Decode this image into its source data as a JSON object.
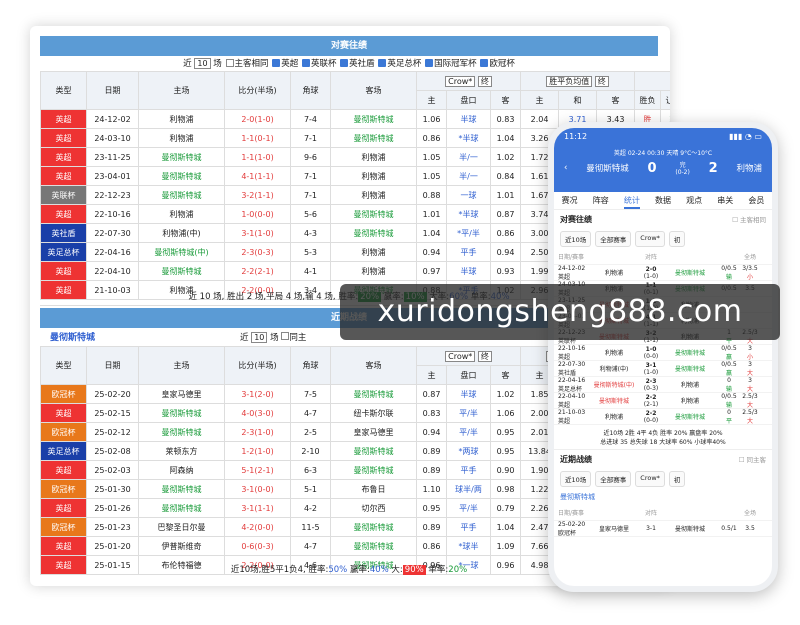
{
  "h2h": {
    "title": "对赛往绩",
    "filter": {
      "near": "近",
      "count": "10",
      "unit": "场",
      "same": "主客相同",
      "tags": [
        "英超",
        "英联杯",
        "英社盾",
        "英足总杯",
        "国际冠军杯",
        "欧冠杯"
      ]
    },
    "odds_sel": "Crow*",
    "end_sel": "终",
    "avg_sel": "胜平负均值",
    "all_sel": "全场",
    "head": [
      "类型",
      "日期",
      "主场",
      "比分(半场)",
      "角球",
      "客场",
      "主",
      "盘口",
      "客",
      "主",
      "和",
      "客",
      "胜负",
      "让球",
      "进球数"
    ],
    "rows": [
      {
        "t": "英超",
        "c": "#e33",
        "d": "24-12-02",
        "h": "利物浦",
        "hc": "",
        "s": "2-0(1-0)",
        "k": "7-4",
        "a": "曼彻斯特城",
        "ac": "grn",
        "o1": "1.06",
        "p": "半球",
        "o2": "0.83",
        "e1": "2.04",
        "e2": "3.71",
        "e3": "3.43",
        "r1": "胜",
        "r2": "输",
        "r3": "小"
      },
      {
        "t": "英超",
        "c": "#e33",
        "d": "24-03-10",
        "h": "利物浦",
        "hc": "",
        "s": "1-1(0-1)",
        "k": "7-1",
        "a": "曼彻斯特城",
        "ac": "grn",
        "o1": "0.86",
        "p": "*半球",
        "o2": "1.04",
        "e1": "3.26",
        "e2": "3.80",
        "e3": "2.08",
        "r1": "",
        "r2": "",
        "r3": ""
      },
      {
        "t": "英超",
        "c": "#e33",
        "d": "23-11-25",
        "h": "曼彻斯特城",
        "hc": "grn",
        "s": "1-1(1-0)",
        "k": "9-6",
        "a": "利物浦",
        "ac": "",
        "o1": "1.05",
        "p": "半/一",
        "o2": "1.02",
        "e1": "1.72",
        "e2": "4.21",
        "e3": "4.21",
        "r1": "",
        "r2": "",
        "r3": ""
      },
      {
        "t": "英超",
        "c": "#e33",
        "d": "23-04-01",
        "h": "曼彻斯特城",
        "hc": "grn",
        "s": "4-1(1-1)",
        "k": "7-1",
        "a": "利物浦",
        "ac": "",
        "o1": "1.05",
        "p": "半/一",
        "o2": "0.84",
        "e1": "1.61",
        "e2": "4.23",
        "e3": "5.23",
        "r1": "",
        "r2": "",
        "r3": ""
      },
      {
        "t": "英联杯",
        "c": "#777",
        "d": "22-12-23",
        "h": "曼彻斯特城",
        "hc": "grn",
        "s": "3-2(1-1)",
        "k": "7-1",
        "a": "利物浦",
        "ac": "",
        "o1": "0.88",
        "p": "一球",
        "o2": "1.01",
        "e1": "1.67",
        "e2": "4.19",
        "e3": "4.60",
        "r1": "",
        "r2": "",
        "r3": ""
      },
      {
        "t": "英超",
        "c": "#e33",
        "d": "22-10-16",
        "h": "利物浦",
        "hc": "",
        "s": "1-0(0-0)",
        "k": "5-6",
        "a": "曼彻斯特城",
        "ac": "grn",
        "o1": "1.01",
        "p": "*半球",
        "o2": "0.87",
        "e1": "3.74",
        "e2": "4.08",
        "e3": "1.87",
        "r1": "",
        "r2": "",
        "r3": ""
      },
      {
        "t": "英社盾",
        "c": "#1a3fa8",
        "d": "22-07-30",
        "h": "利物浦(中)",
        "hc": "",
        "s": "3-1(1-0)",
        "k": "4-3",
        "a": "曼彻斯特城",
        "ac": "grn",
        "o1": "1.04",
        "p": "*平/半",
        "o2": "0.86",
        "e1": "3.00",
        "e2": "3.53",
        "e3": "2.33",
        "r1": "",
        "r2": "",
        "r3": ""
      },
      {
        "t": "英足总杯",
        "c": "#1a3fa8",
        "d": "22-04-16",
        "h": "曼彻斯特城(中)",
        "hc": "grn",
        "s": "2-3(0-3)",
        "k": "5-3",
        "a": "利物浦",
        "ac": "",
        "o1": "0.94",
        "p": "平手",
        "o2": "0.94",
        "e1": "2.50",
        "e2": "3.38",
        "e3": "2.77",
        "r1": "",
        "r2": "",
        "r3": ""
      },
      {
        "t": "英超",
        "c": "#e33",
        "d": "22-04-10",
        "h": "曼彻斯特城",
        "hc": "grn",
        "s": "2-2(2-1)",
        "k": "4-1",
        "a": "利物浦",
        "ac": "",
        "o1": "0.97",
        "p": "半球",
        "o2": "0.93",
        "e1": "1.99",
        "e2": "3.67",
        "e3": "3.64",
        "r1": "",
        "r2": "",
        "r3": ""
      },
      {
        "t": "英超",
        "c": "#e33",
        "d": "21-10-03",
        "h": "利物浦",
        "hc": "",
        "s": "2-2(0-0)",
        "k": "3-4",
        "a": "曼彻斯特城",
        "ac": "grn",
        "o1": "0.88",
        "p": "*平手",
        "o2": "1.02",
        "e1": "2.96",
        "e2": "3.54",
        "e3": "2.33",
        "r1": "",
        "r2": "",
        "r3": ""
      }
    ],
    "foot": {
      "text": "近 10 场, 胜出 2 场,平局 4 场,输 4 场, 胜率:",
      "win": "20%",
      "dx": "赢率:",
      "dxv": "10%",
      "big": "大率:",
      "bigv": "60%",
      "sp": "单率:",
      "spv": "40%"
    }
  },
  "recent": {
    "title": "近期战绩",
    "team": "曼彻斯特城",
    "filter": {
      "near": "近",
      "count": "10",
      "unit": "场",
      "same": "同主",
      "tags": [
        "英超",
        "欧冠杯",
        "英足总杯",
        "英联杯"
      ]
    },
    "rows": [
      {
        "t": "欧冠杯",
        "c": "#e8781b",
        "d": "25-02-20",
        "h": "皇家马德里",
        "s": "3-1(2-0)",
        "k": "7-5",
        "a": "曼彻斯特城",
        "o1": "0.87",
        "p": "半球",
        "o2": "1.02",
        "e1": "1.85",
        "e2": "4.23",
        "e3": "3.69"
      },
      {
        "t": "英超",
        "c": "#e33",
        "d": "25-02-15",
        "h": "曼彻斯特城",
        "s": "4-0(3-0)",
        "k": "4-7",
        "a": "纽卡斯尔联",
        "o1": "0.83",
        "p": "平/半",
        "o2": "1.06",
        "e1": "2.00",
        "e2": "4.01",
        "e3": "3.55"
      },
      {
        "t": "欧冠杯",
        "c": "#e8781b",
        "d": "25-02-12",
        "h": "曼彻斯特城",
        "s": "2-3(1-0)",
        "k": "2-5",
        "a": "皇家马德里",
        "o1": "0.94",
        "p": "平/半",
        "o2": "0.95",
        "e1": "2.01",
        "e2": "3.92",
        "e3": "3.39"
      },
      {
        "t": "英足总杯",
        "c": "#1a3fa8",
        "d": "25-02-08",
        "h": "莱顿东方",
        "s": "1-2(1-0)",
        "k": "2-10",
        "a": "曼彻斯特城",
        "o1": "0.89",
        "p": "*两球",
        "o2": "0.95",
        "e1": "13.84",
        "e2": "7.73",
        "e3": "1.17"
      },
      {
        "t": "英超",
        "c": "#e33",
        "d": "25-02-03",
        "h": "阿森纳",
        "s": "5-1(2-1)",
        "k": "6-3",
        "a": "曼彻斯特城",
        "o1": "0.89",
        "p": "平手",
        "o2": "0.90",
        "e1": "1.90",
        "e2": "3.89",
        "e3": "3.55"
      },
      {
        "t": "欧冠杯",
        "c": "#e8781b",
        "d": "25-01-30",
        "h": "曼彻斯特城",
        "s": "3-1(0-0)",
        "k": "5-1",
        "a": "布鲁日",
        "o1": "1.10",
        "p": "球半/两",
        "o2": "0.98",
        "e1": "1.22",
        "e2": "6.89",
        "e3": "11.64"
      },
      {
        "t": "英超",
        "c": "#e33",
        "d": "25-01-26",
        "h": "曼彻斯特城",
        "s": "3-1(1-1)",
        "k": "4-2",
        "a": "切尔西",
        "o1": "0.95",
        "p": "平/半",
        "o2": "0.79",
        "e1": "2.26",
        "e2": "3.81",
        "e3": "2.89"
      },
      {
        "t": "欧冠杯",
        "c": "#e8781b",
        "d": "25-01-23",
        "h": "巴黎圣日尔曼",
        "s": "4-2(0-0)",
        "k": "11-5",
        "a": "曼彻斯特城",
        "o1": "0.89",
        "p": "平手",
        "o2": "1.04",
        "e1": "2.47",
        "e2": "3.64",
        "e3": "2.59"
      },
      {
        "t": "英超",
        "c": "#e33",
        "d": "25-01-20",
        "h": "伊普斯维奇",
        "s": "0-6(0-3)",
        "k": "4-7",
        "a": "曼彻斯特城",
        "o1": "0.86",
        "p": "*球半",
        "o2": "1.09",
        "e1": "7.66",
        "e2": "5.19",
        "e3": "1.38"
      },
      {
        "t": "英超",
        "c": "#e33",
        "d": "25-01-15",
        "h": "布伦特福德",
        "s": "2-2(0-0)",
        "k": "4-6",
        "a": "曼彻斯特城",
        "o1": "0.96",
        "p": "*一球",
        "o2": "0.96",
        "e1": "4.98",
        "e2": "4.46",
        "e3": "1.66"
      }
    ],
    "foot": {
      "text": "近10场,胜5平1负4, 胜率:",
      "win": "50%",
      "dx": "赢率:",
      "dxv": "40%",
      "big": "大:",
      "bigv": "90%",
      "sp": "单率:",
      "spv": "20%"
    }
  },
  "watermark": "xuridongsheng888.com",
  "phone": {
    "time": "11:12",
    "league": "英超",
    "datetime": "02-24 00:30",
    "weather": "天晴 9°C～10°C",
    "home": "曼彻斯特城",
    "away": "利物浦",
    "score_h": "0",
    "score_a": "2",
    "vs": "完",
    "half": "(0-2)",
    "tabs": [
      "赛况",
      "阵容",
      "统计",
      "数据",
      "观点",
      "串关",
      "会员"
    ],
    "active_tab": "统计",
    "sec1": "对赛往绩",
    "same": "主客相同",
    "f1": [
      "近10场",
      "全部赛事",
      "Crow*",
      "初"
    ],
    "cols": [
      "日期/赛事",
      "",
      "对阵",
      "",
      "全场"
    ],
    "rows": [
      {
        "d": "24-12-02",
        "l": "英超",
        "h": "利物浦",
        "s": "2-0",
        "hs": "(1-0)",
        "a": "曼彻斯特城",
        "o": "0/0.5",
        "ox": "输",
        "g": "3/3.5",
        "gx": "小"
      },
      {
        "d": "24-03-10",
        "l": "英超",
        "h": "利物浦",
        "s": "1-1",
        "hs": "(0-1)",
        "a": "曼彻斯特城",
        "o": "0/0.5",
        "ox": "",
        "g": "3.5",
        "gx": ""
      },
      {
        "d": "23-11-25",
        "l": "英超",
        "h": "曼彻斯特城",
        "s": "1-1",
        "hs": "(1-0)",
        "a": "利物浦",
        "o": "",
        "ox": "",
        "g": "",
        "gx": ""
      },
      {
        "d": "23-04-01",
        "l": "英超",
        "h": "曼彻斯特城",
        "s": "4-1",
        "hs": "(1-1)",
        "a": "利物浦",
        "o": "",
        "ox": "",
        "g": "",
        "gx": ""
      },
      {
        "d": "22-12-23",
        "l": "英联杯",
        "h": "曼彻斯特城",
        "s": "3-2",
        "hs": "(1-1)",
        "a": "利物浦",
        "o": "1",
        "ox": "平",
        "g": "2.5/3",
        "gx": "大"
      },
      {
        "d": "22-10-16",
        "l": "英超",
        "h": "利物浦",
        "s": "1-0",
        "hs": "(0-0)",
        "a": "曼彻斯特城",
        "o": "0/0.5",
        "ox": "赢",
        "g": "3",
        "gx": "小"
      },
      {
        "d": "22-07-30",
        "l": "英社盾",
        "h": "利物浦(中)",
        "s": "3-1",
        "hs": "(1-0)",
        "a": "曼彻斯特城",
        "o": "0/0.5",
        "ox": "赢",
        "g": "3",
        "gx": "大"
      },
      {
        "d": "22-04-16",
        "l": "英足总杯",
        "h": "曼彻斯特城(中)",
        "s": "2-3",
        "hs": "(0-3)",
        "a": "利物浦",
        "o": "0",
        "ox": "输",
        "g": "3",
        "gx": "大"
      },
      {
        "d": "22-04-10",
        "l": "英超",
        "h": "曼彻斯特城",
        "s": "2-2",
        "hs": "(2-1)",
        "a": "利物浦",
        "o": "0/0.5",
        "ox": "输",
        "g": "2.5/3",
        "gx": "大"
      },
      {
        "d": "21-10-03",
        "l": "英超",
        "h": "利物浦",
        "s": "2-2",
        "hs": "(0-0)",
        "a": "曼彻斯特城",
        "o": "0",
        "ox": "平",
        "g": "2.5/3",
        "gx": "大"
      }
    ],
    "sum1": "近10场 2胜 4平 4负 胜率 20% 赢盘率 20%",
    "sum2": "总进球 35 总失球 18 大球率 60% 小球率40%",
    "sec2": "近期战绩",
    "same2": "同主客",
    "f2": [
      "近10场",
      "全部赛事",
      "Crow*",
      "初"
    ],
    "team2": "曼彻斯特城",
    "cols2": [
      "日期/赛事",
      "对阵",
      "全场"
    ],
    "r2": {
      "d": "25-02-20",
      "l": "欧冠杯",
      "h": "皇家马德里",
      "s": "3-1",
      "a": "曼彻斯特城",
      "o": "0.5/1",
      "ox": "输",
      "g": "3.5",
      "gx": "大"
    }
  }
}
